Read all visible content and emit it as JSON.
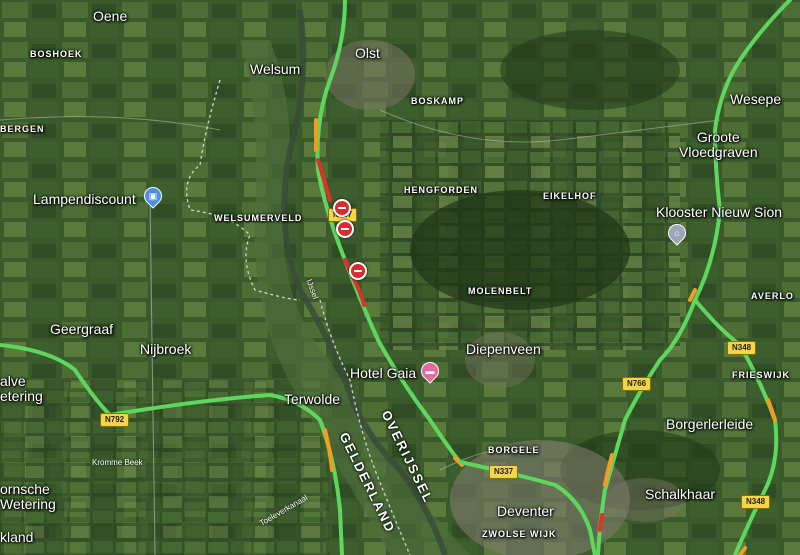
{
  "map": {
    "places": {
      "oene": "Oene",
      "boshoek": "BOSHOEK",
      "olst": "Olst",
      "welsum": "Welsum",
      "boskamp": "BOSKAMP",
      "wesepe": "Wesepe",
      "bergen": "BERGEN",
      "groote_vloedgraven": "Groote\nVloedgraven",
      "hengforden": "HENGFORDEN",
      "eikelhof": "EIKELHOF",
      "welsumerveld": "WELSUMERVELD",
      "klooster": "Klooster Nieuw Sion",
      "averlo": "AVERLO",
      "molenbelt": "MOLENBELT",
      "geergraaf": "Geergraaf",
      "nijbroek": "Nijbroek",
      "diepenveen": "Diepenveen",
      "frieswijk": "FRIESWIJK",
      "halve_wetering": "alve\netering",
      "terwolde": "Terwolde",
      "borgerlerleide": "Borgerlerleide",
      "borgele": "BORGELE",
      "schalkhaar": "Schalkhaar",
      "deventer": "Deventer",
      "zwolse_wijk": "ZWOLSE WIJK",
      "dornsche_wetering": "ornsche\nWetering",
      "kland": "kland"
    },
    "pois": {
      "lampendiscount": "Lampendiscount",
      "hotel_gaia": "Hotel Gaia"
    },
    "waters": {
      "ijssel": "IJssel",
      "kromme_beek": "Kromme Beek",
      "toeleverkanaal": "Toeleverkanaal"
    },
    "provinces": {
      "gelderland": "GELDERLAND",
      "overijssel": "OVERIJSSEL"
    },
    "roads": {
      "n337_top": "N337",
      "n792": "N792",
      "n766": "N766",
      "n348_top": "N348",
      "n337": "N337",
      "n348_bottom": "N348"
    },
    "icons": {
      "shop": "shop-pin-icon",
      "hotel": "hotel-pin-icon",
      "monastery": "place-of-worship-icon",
      "closure": "road-closure-icon"
    },
    "colors": {
      "traffic_free": "#5ed75e",
      "traffic_slow": "#f59a23",
      "traffic_jam": "#e0302a",
      "poi_blue": "#4a8fe0",
      "poi_pink": "#e26aa0"
    }
  }
}
